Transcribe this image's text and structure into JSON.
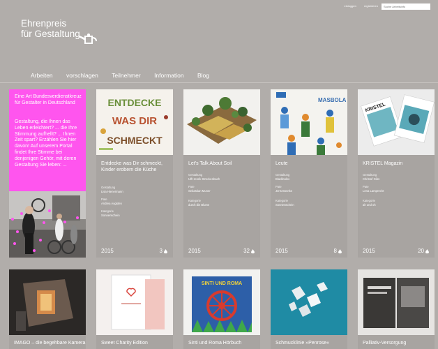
{
  "header": {
    "login": "einloggen",
    "register": "registrieren",
    "search_placeholder": "Suche Arbeitsinfo",
    "logo_line1": "Ehrenpreis",
    "logo_line2": "für Gestaltung"
  },
  "nav": [
    "Arbeiten",
    "vorschlagen",
    "Teilnehmer",
    "Information",
    "Blog"
  ],
  "promo": {
    "heading": "Eine Art Bundesverdienstkreuz für Gestalter in Deutschland",
    "body": "Gestaltung, die Ihnen das Leben erleichtert? ... die Ihre Stimmung aufhellt? ... Ihnen Zeit spart? Erzählen Sie hier davon! Auf unserem Portal findet Ihre Stimme bei denjenigen Gehör, mit deren Gestaltung Sie leben: ..."
  },
  "cards": [
    {
      "title": "Entdecke was Dir schmeckt, Kinder erobern die Küche",
      "meta": [
        {
          "label": "Gestaltung",
          "value": "Lisa Hienermann"
        },
        {
          "label": "Pate",
          "value": "Andrea Augsten"
        },
        {
          "label": "Kategorie",
          "value": "Sonnenschein"
        }
      ],
      "year": "2015",
      "count": "3"
    },
    {
      "title": "Let's Talk About Soil",
      "meta": [
        {
          "label": "Gestaltung",
          "value": "Ulf Henrik Streckenbach"
        },
        {
          "label": "Pate",
          "value": "Sebastian Muner"
        },
        {
          "label": "Kategorie",
          "value": "durch die Blume"
        }
      ],
      "year": "2015",
      "count": "32"
    },
    {
      "title": "Leute",
      "meta": [
        {
          "label": "Gestaltung",
          "value": "Blackbolex"
        },
        {
          "label": "Pate",
          "value": "Jens Bonnke"
        },
        {
          "label": "Kategorie",
          "value": "Sonnenschein"
        }
      ],
      "year": "2015",
      "count": "8"
    },
    {
      "title": "KRISTEL Magazin",
      "meta": [
        {
          "label": "Gestaltung",
          "value": "Christof Gibs"
        },
        {
          "label": "Pate",
          "value": "Lena Lamprecht"
        },
        {
          "label": "Kategorie",
          "value": "ah und oh"
        }
      ],
      "year": "2015",
      "count": "20"
    }
  ],
  "row2": [
    {
      "title": "IMAGO – die begehbare Kamera"
    },
    {
      "title": "Sweet Charity Edition"
    },
    {
      "title": "Sinti und Roma Hörbuch"
    },
    {
      "title": "Schmucklinie »Penrose«"
    },
    {
      "title": "Palliativ-Versorgung"
    }
  ],
  "images": {
    "card1_text": "Entdecke was Dir schmeckt",
    "card3_brand": "MASBOLA",
    "card4_brand": "KRISTEL",
    "sinti_cover": "SINTI UND ROMA"
  }
}
